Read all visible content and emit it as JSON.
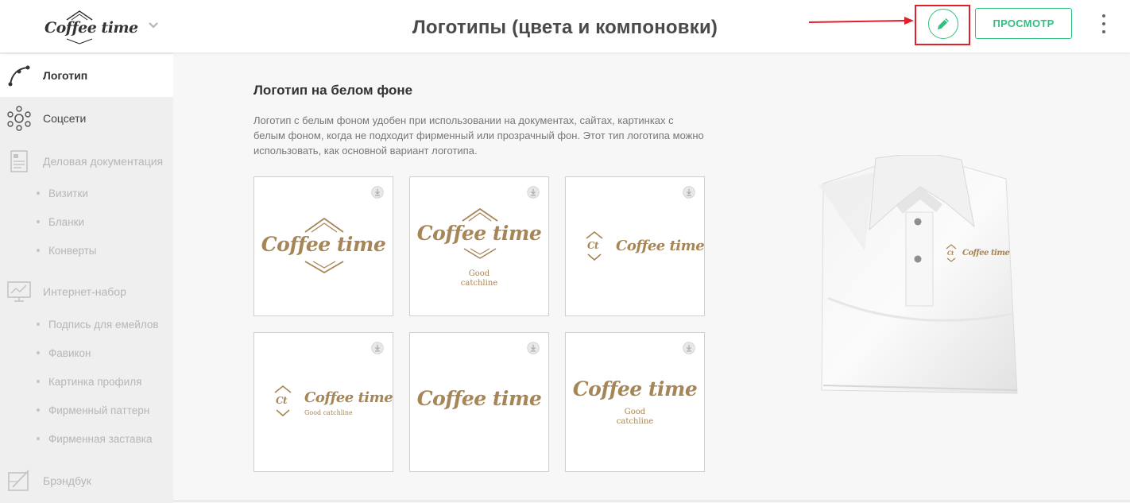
{
  "header": {
    "brand_text": "Coffee time",
    "title": "Логотипы (цвета и компоновки)",
    "preview_label": "ПРОСМОТР"
  },
  "sidebar": {
    "items": [
      {
        "label": "Логотип",
        "icon": "logo-curve-icon",
        "active": true
      },
      {
        "label": "Соцсети",
        "icon": "social-network-icon"
      },
      {
        "label": "Деловая документация",
        "icon": "document-icon",
        "children": [
          "Визитки",
          "Бланки",
          "Конверты"
        ]
      },
      {
        "label": "Интернет-набор",
        "icon": "monitor-icon",
        "children": [
          "Подпись для емейлов",
          "Фавикон",
          "Картинка профиля",
          "Фирменный паттерн",
          "Фирменная заставка"
        ]
      },
      {
        "label": "Брэндбук",
        "icon": "brandbook-icon"
      }
    ]
  },
  "section": {
    "title": "Логотип на белом фоне",
    "description": "Логотип с белым фоном удобен при использовании на документах, сайтах, картинках с белым фоном, когда не подходит фирменный или прозрачный фон. Этот тип логотипа можно использовать, как основной вариант логотипа."
  },
  "logos": [
    {
      "text": "Coffee time",
      "variant": "framed-diamond"
    },
    {
      "text": "Coffee time",
      "catchline": "Good\ncatchline",
      "variant": "mountain-stacked"
    },
    {
      "text": "Coffee time",
      "monogram": "Ct",
      "variant": "monogram-inline"
    },
    {
      "text": "Coffee time",
      "monogram": "Ct",
      "catchline": "Good catchline",
      "variant": "monogram-inline-catchline"
    },
    {
      "text": "Coffee time",
      "variant": "wordmark"
    },
    {
      "text": "Coffee time",
      "catchline": "Good\ncatchline",
      "variant": "wordmark-catchline"
    }
  ],
  "mockup": {
    "text": "Coffee time",
    "monogram": "Ct"
  },
  "colors": {
    "accent": "#2ec27e",
    "logo_gold": "#a68556",
    "highlight_red": "#e0202b"
  }
}
